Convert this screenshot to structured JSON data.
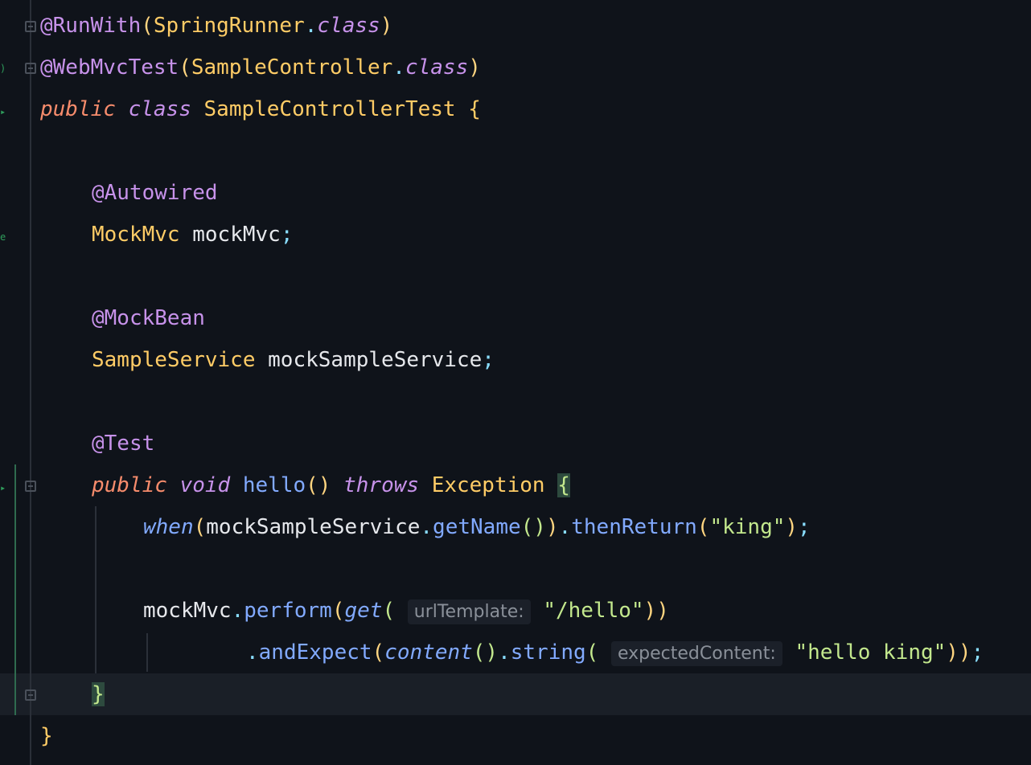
{
  "code": {
    "line1": {
      "at": "@RunWith",
      "open": "(",
      "cls": "SpringRunner",
      "dot": ".",
      "kw": "class",
      "close": ")"
    },
    "line2": {
      "at": "@WebMvcTest",
      "open": "(",
      "cls": "SampleController",
      "dot": ".",
      "kw": "class",
      "close": ")"
    },
    "line3": {
      "kw1": "public",
      "kw2": "class",
      "name": "SampleControllerTest",
      "brace": "{"
    },
    "line5": {
      "at": "@Autowired"
    },
    "line6": {
      "type": "MockMvc",
      "name": "mockMvc",
      "semi": ";"
    },
    "line8": {
      "at": "@MockBean"
    },
    "line9": {
      "type": "SampleService",
      "name": "mockSampleService",
      "semi": ";"
    },
    "line11": {
      "at": "@Test"
    },
    "line12": {
      "kw1": "public",
      "kw2": "void",
      "fn": "hello",
      "parens": "()",
      "throws": "throws",
      "exc": "Exception",
      "brace": "{"
    },
    "line13": {
      "when": "when",
      "open": "(",
      "obj": "mockSampleService",
      "dot": ".",
      "fn": "getName",
      "inner": "()",
      "close": ")",
      "dot2": ".",
      "fn2": "thenReturn",
      "open2": "(",
      "str": "\"king\"",
      "close2": ")",
      "semi": ";"
    },
    "line15": {
      "obj": "mockMvc",
      "dot": ".",
      "fn": "perform",
      "open": "(",
      "fn2": "get",
      "open2": "(",
      "hint": "urlTemplate:",
      "str": "\"/hello\"",
      "close": "))"
    },
    "line16": {
      "dot": ".",
      "fn": "andExpect",
      "open": "(",
      "fn2": "content",
      "inner": "()",
      "dot2": ".",
      "fn3": "string",
      "open2": "(",
      "hint": "expectedContent:",
      "str": "\"hello king\"",
      "close": "))",
      "semi": ";"
    },
    "line17": {
      "brace": "}"
    },
    "line18": {
      "brace": "}"
    }
  }
}
